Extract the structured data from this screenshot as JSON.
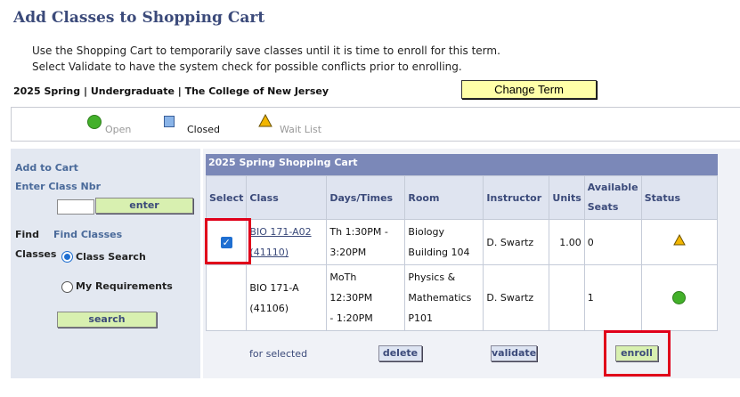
{
  "page": {
    "title": "Add Classes to Shopping Cart",
    "instructions": [
      "Use the Shopping Cart to temporarily save classes until it is time to enroll for this term.",
      "Select Validate to have the system check for possible conflicts prior to enrolling."
    ],
    "term_line": "2025 Spring | Undergraduate | The College of New Jersey",
    "change_term_label": "Change Term"
  },
  "legend": {
    "open": "Open",
    "closed": "Closed",
    "wait_list": "Wait List"
  },
  "sidebar": {
    "add_to_cart": "Add to Cart",
    "enter_class_nbr": "Enter Class Nbr",
    "class_nbr_value": "",
    "enter_button": "enter",
    "find": "Find",
    "classes": "Classes",
    "find_classes": "Find Classes",
    "class_search": "Class Search",
    "my_requirements": "My Requirements",
    "search_button": "search",
    "selected_option": "Class Search"
  },
  "cart": {
    "header": "2025 Spring Shopping Cart",
    "columns": [
      "Select",
      "Class",
      "Days/Times",
      "Room",
      "Instructor",
      "Units",
      "Available Seats",
      "Status"
    ],
    "rows": [
      {
        "selected": true,
        "class_line1": "BIO 171-A02",
        "class_line2": "(41110)",
        "days_line1": "Th 1:30PM -",
        "days_line2": "3:20PM",
        "room_line1": "Biology",
        "room_line2": "Building 104",
        "room_line3": "",
        "instructor": "D. Swartz",
        "units": "1.00",
        "available_seats": "0",
        "status": "wait-list-icon"
      },
      {
        "selected": false,
        "class_line1": "BIO 171-A",
        "class_line2": "(41106)",
        "days_line1": "MoTh 12:30PM",
        "days_line2": "- 1:20PM",
        "room_line1": "Physics &",
        "room_line2": "Mathematics",
        "room_line3": "P101",
        "instructor": "D. Swartz",
        "units": "",
        "available_seats": "1",
        "status": "open-icon"
      }
    ],
    "for_selected": "for selected",
    "delete_button": "delete",
    "validate_button": "validate",
    "enroll_button": "enroll"
  },
  "colors": {
    "open": "#43b02a",
    "closed": "#8ab4e8",
    "wait_list": "#f2b600",
    "highlight": "#e0001a"
  }
}
